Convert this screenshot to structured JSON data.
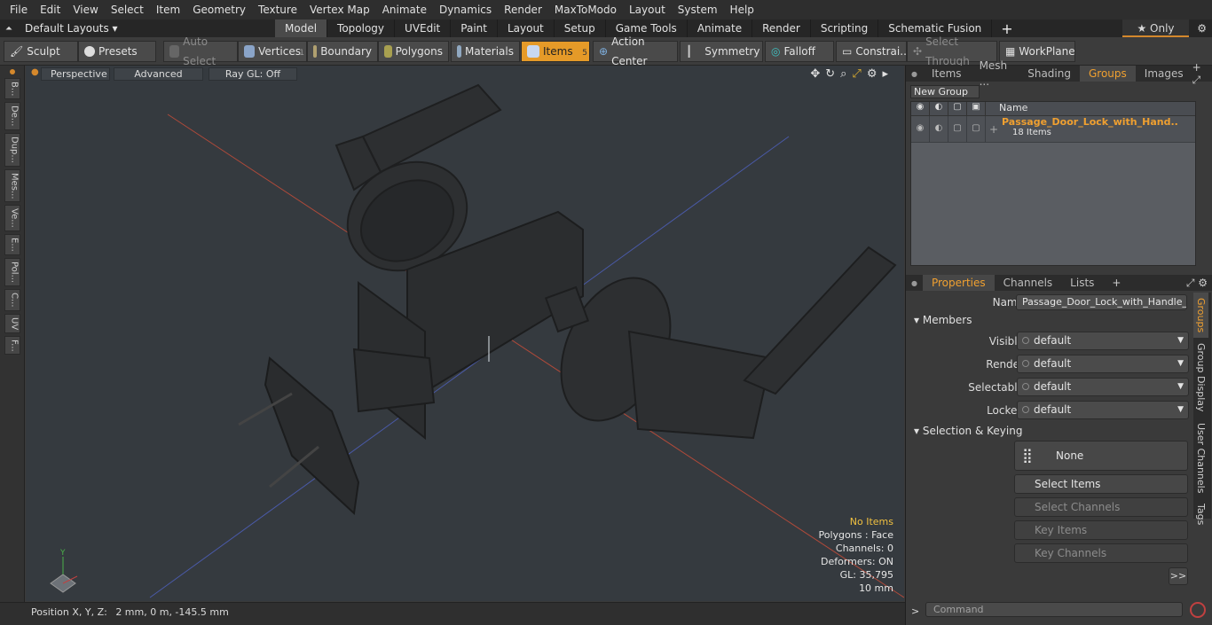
{
  "menu": [
    "File",
    "Edit",
    "View",
    "Select",
    "Item",
    "Geometry",
    "Texture",
    "Vertex Map",
    "Animate",
    "Dynamics",
    "Render",
    "MaxToModo",
    "Layout",
    "System",
    "Help"
  ],
  "tabbar": {
    "layouts": "Default Layouts ▾",
    "tabs": [
      "Model",
      "Topology",
      "UVEdit",
      "Paint",
      "Layout",
      "Setup",
      "Game Tools",
      "Animate",
      "Render",
      "Scripting",
      "Schematic Fusion"
    ],
    "active": "Model",
    "plus": "+",
    "only": "★  Only",
    "gear": "⚙"
  },
  "toolbar": {
    "sculpt": "Sculpt",
    "presets": "Presets",
    "auto_select": "Auto Select",
    "vertices": "Vertices",
    "vertices_count": "1",
    "boundary": "Boundary",
    "polygons": "Polygons",
    "materials": "Materials",
    "items": "Items",
    "items_count": "5",
    "action_center": "Action Center",
    "symmetry": "Symmetry",
    "falloff": "Falloff",
    "constraints": "Constrai...",
    "select_through": "Select Through",
    "workplane": "WorkPlane"
  },
  "left_tools": [
    "B...",
    "De...",
    "Dup...",
    "Mes...",
    "Ve...",
    "E...",
    "Pol...",
    "C...",
    "UV",
    "F..."
  ],
  "viewport": {
    "perspective": "Perspective",
    "advanced": "Advanced",
    "raygl": "Ray GL: Off",
    "stats": {
      "items": "No Items",
      "polygons": "Polygons : Face",
      "channels": "Channels: 0",
      "deformers": "Deformers: ON",
      "gl": "GL: 35,795",
      "scale": "10 mm"
    }
  },
  "status": {
    "position_label": "Position X, Y, Z:",
    "position_value": "2 mm, 0 m, -145.5 mm"
  },
  "panel_top": {
    "tabs": [
      "Items",
      "Mesh ...",
      "Shading",
      "Groups",
      "Images"
    ],
    "active": "Groups",
    "new_group": "New Group",
    "col_name": "Name",
    "group_name": "Passage_Door_Lock_with_Hand...",
    "group_count": "18 Items"
  },
  "panel_bottom": {
    "tabs": [
      "Properties",
      "Channels",
      "Lists"
    ],
    "active": "Properties",
    "name_label": "Name",
    "name_value": "Passage_Door_Lock_with_Handle_Gol",
    "members": "Members",
    "visible_label": "Visible",
    "render_label": "Render",
    "selectable_label": "Selectable",
    "locked_label": "Locked",
    "dd_value": "default",
    "sel_keying": "Selection & Keying",
    "none_btn": "None",
    "select_items": "Select Items",
    "select_channels": "Select Channels",
    "key_items": "Key Items",
    "key_channels": "Key Channels",
    "more": ">>",
    "side_tabs": [
      "Groups",
      "Group Display",
      "User Channels",
      "Tags"
    ]
  },
  "command": {
    "prompt": ">",
    "placeholder": "Command"
  }
}
